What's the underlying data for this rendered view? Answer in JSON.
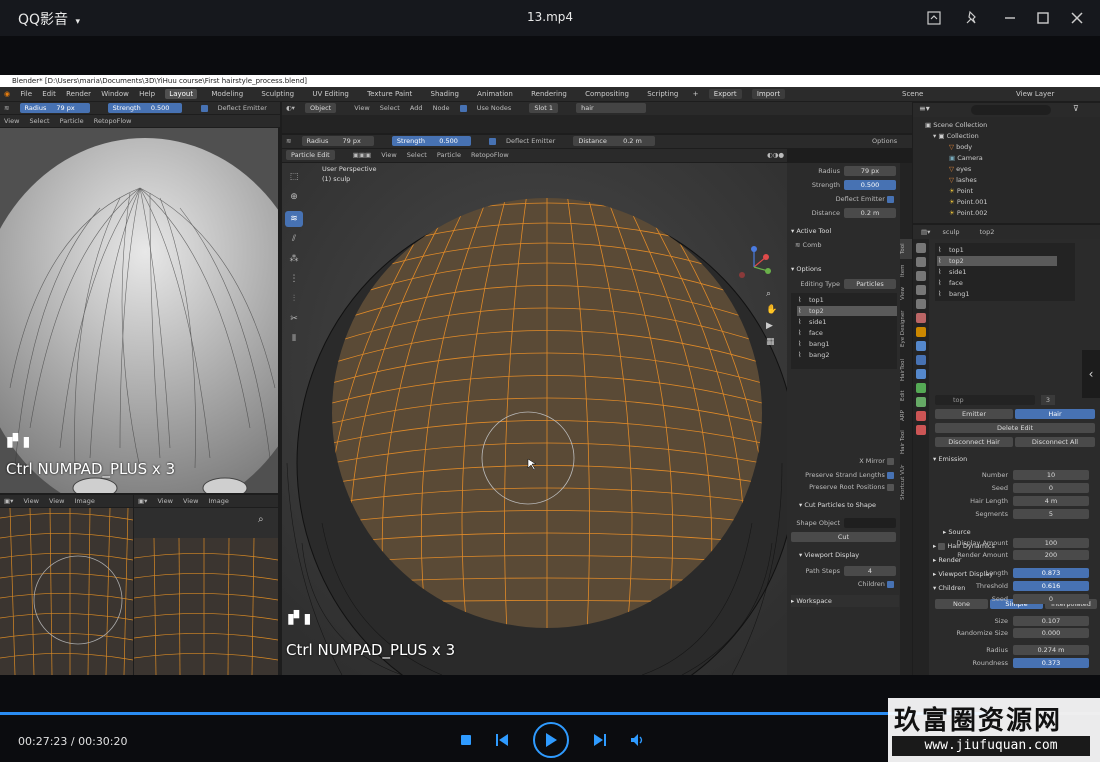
{
  "player": {
    "app_title": "QQ影音",
    "file_name": "13.mp4",
    "time_current": "00:27:23",
    "time_total": "00:30:20",
    "progress": 0.902,
    "accent": "#2a8cf2"
  },
  "blender": {
    "window_title": "Blender* [D:\\Users\\maria\\Documents\\3D\\YiHuu course\\First hairstyle_process.blend]",
    "menu": [
      "File",
      "Edit",
      "Render",
      "Window",
      "Help"
    ],
    "workspaces": [
      "Layout",
      "Modeling",
      "Sculpting",
      "UV Editing",
      "Texture Paint",
      "Shading",
      "Animation",
      "Rendering",
      "Compositing",
      "Scripting"
    ],
    "active_workspace": "Layout",
    "export_btn": "Export",
    "import_btn": "Import",
    "scene": "Scene",
    "view_layer": "View Layer"
  },
  "left_viewport": {
    "header_items": [
      "View",
      "Select",
      "Particle"
    ],
    "radius_label": "Radius",
    "radius_value": "79 px",
    "strength_label": "Strength",
    "strength_value": "0.500",
    "deflect": "Deflect Emitter",
    "retopoflow": "RetopoFlow",
    "overlay": "Ctrl NUMPAD_PLUS x 3"
  },
  "left_bottom": {
    "header_items": [
      "View",
      "View",
      "Image"
    ],
    "header_items_2": [
      "View",
      "View",
      "Image"
    ]
  },
  "node_header": {
    "object": "Object",
    "items": [
      "View",
      "Select",
      "Add",
      "Node"
    ],
    "use_nodes": "Use Nodes",
    "slot": "Slot 1",
    "material": "hair"
  },
  "main_viewport": {
    "radius_label": "Radius",
    "radius_value": "79 px",
    "strength_label": "Strength",
    "strength_value": "0.500",
    "deflect": "Deflect Emitter",
    "distance_label": "Distance",
    "distance_value": "0.2 m",
    "mode": "Particle Edit",
    "header_items": [
      "View",
      "Select",
      "Particle"
    ],
    "retopoflow": "RetopoFlow",
    "options_btn": "Options",
    "perspective": "User Perspective",
    "collection": "(1) sculp",
    "overlay": "Ctrl NUMPAD_PLUS x 3"
  },
  "npanel": {
    "radius_label": "Radius",
    "radius_value": "79 px",
    "strength_label": "Strength",
    "strength_value": "0.500",
    "deflect": "Deflect Emitter",
    "distance_label": "Distance",
    "distance_value": "0.2 m",
    "active_tool": "Active Tool",
    "tool_name": "Comb",
    "options": "Options",
    "editing_type_label": "Editing Type",
    "editing_type": "Particles",
    "list": [
      "top1",
      "top2",
      "side1",
      "face",
      "bang1",
      "bang2"
    ],
    "selected": "top2",
    "x_mirror": "X Mirror",
    "preserve_strand": "Preserve Strand Lengths",
    "preserve_root": "Preserve Root Positions",
    "cut_particles": "Cut Particles to Shape",
    "shape_object": "Shape Object",
    "cut_btn": "Cut",
    "viewport_display": "Viewport Display",
    "path_steps_label": "Path Steps",
    "path_steps_value": "4",
    "children": "Children",
    "workspace": "Workspace",
    "tabs": [
      "Tool",
      "Item",
      "View",
      "Eye Designer",
      "HairTool",
      "Edit",
      "ARP",
      "Hair Tool",
      "Shortcut VUr"
    ]
  },
  "outliner": {
    "scene_collection": "Scene Collection",
    "collection": "Collection",
    "items": [
      "body",
      "Camera",
      "eyes",
      "lashes",
      "Point",
      "Point.001",
      "Point.002"
    ]
  },
  "properties": {
    "breadcrumb_obj": "sculp",
    "breadcrumb_sys": "top2",
    "systems": [
      "top1",
      "top2",
      "side1",
      "face",
      "bang1"
    ],
    "selected": "top2",
    "name_field": "top",
    "users": "3",
    "emitter": "Emitter",
    "hair": "Hair",
    "delete_edit": "Delete Edit",
    "disconnect_hair": "Disconnect Hair",
    "disconnect_all": "Disconnect All",
    "emission": "Emission",
    "number_label": "Number",
    "number_value": "10",
    "seed_label": "Seed",
    "seed_value": "0",
    "hair_length_label": "Hair Length",
    "hair_length_value": "4 m",
    "segments_label": "Segments",
    "segments_value": "5",
    "source": "Source",
    "hair_dynamics": "Hair Dynamics",
    "render": "Render",
    "viewport_display": "Viewport Display",
    "children": "Children",
    "child_none": "None",
    "child_simple": "Simple",
    "child_interp": "Interpolated",
    "display_amount_label": "Display Amount",
    "display_amount_value": "100",
    "render_amount_label": "Render Amount",
    "render_amount_value": "200",
    "length_label": "Length",
    "length_value": "0.873",
    "threshold_label": "Threshold",
    "threshold_value": "0.616",
    "seed2_label": "Seed",
    "seed2_value": "0",
    "size_label": "Size",
    "size_value": "0.107",
    "rand_size_label": "Randomize Size",
    "rand_size_value": "0.000",
    "radius_label": "Radius",
    "radius_value": "0.274 m",
    "roundness_label": "Roundness",
    "roundness_value": "0.373"
  },
  "watermark": {
    "name": "玖富圈资源网",
    "url": "www.jiufuquan.com"
  }
}
